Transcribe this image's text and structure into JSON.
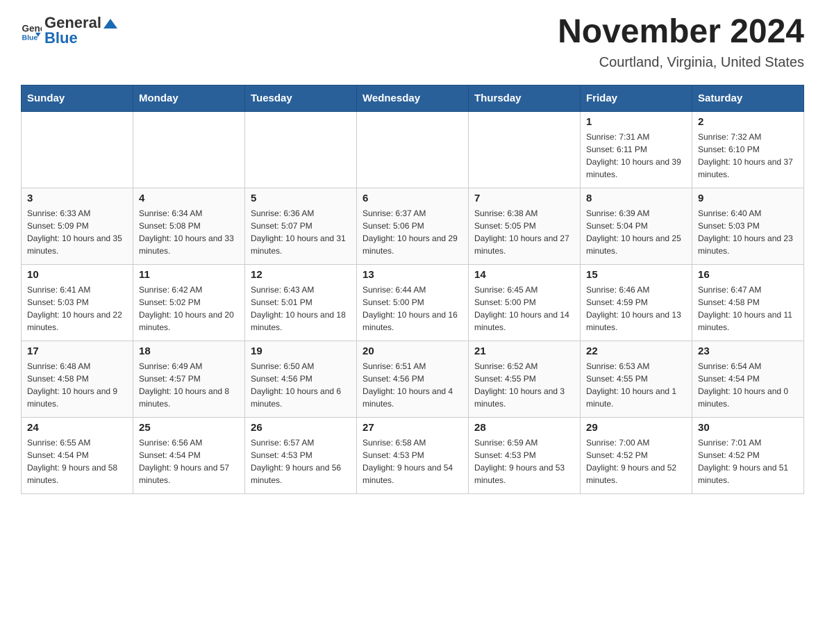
{
  "header": {
    "logo_general": "General",
    "logo_blue": "Blue",
    "month_year": "November 2024",
    "location": "Courtland, Virginia, United States"
  },
  "weekdays": [
    "Sunday",
    "Monday",
    "Tuesday",
    "Wednesday",
    "Thursday",
    "Friday",
    "Saturday"
  ],
  "weeks": [
    [
      {
        "day": "",
        "info": ""
      },
      {
        "day": "",
        "info": ""
      },
      {
        "day": "",
        "info": ""
      },
      {
        "day": "",
        "info": ""
      },
      {
        "day": "",
        "info": ""
      },
      {
        "day": "1",
        "info": "Sunrise: 7:31 AM\nSunset: 6:11 PM\nDaylight: 10 hours and 39 minutes."
      },
      {
        "day": "2",
        "info": "Sunrise: 7:32 AM\nSunset: 6:10 PM\nDaylight: 10 hours and 37 minutes."
      }
    ],
    [
      {
        "day": "3",
        "info": "Sunrise: 6:33 AM\nSunset: 5:09 PM\nDaylight: 10 hours and 35 minutes."
      },
      {
        "day": "4",
        "info": "Sunrise: 6:34 AM\nSunset: 5:08 PM\nDaylight: 10 hours and 33 minutes."
      },
      {
        "day": "5",
        "info": "Sunrise: 6:36 AM\nSunset: 5:07 PM\nDaylight: 10 hours and 31 minutes."
      },
      {
        "day": "6",
        "info": "Sunrise: 6:37 AM\nSunset: 5:06 PM\nDaylight: 10 hours and 29 minutes."
      },
      {
        "day": "7",
        "info": "Sunrise: 6:38 AM\nSunset: 5:05 PM\nDaylight: 10 hours and 27 minutes."
      },
      {
        "day": "8",
        "info": "Sunrise: 6:39 AM\nSunset: 5:04 PM\nDaylight: 10 hours and 25 minutes."
      },
      {
        "day": "9",
        "info": "Sunrise: 6:40 AM\nSunset: 5:03 PM\nDaylight: 10 hours and 23 minutes."
      }
    ],
    [
      {
        "day": "10",
        "info": "Sunrise: 6:41 AM\nSunset: 5:03 PM\nDaylight: 10 hours and 22 minutes."
      },
      {
        "day": "11",
        "info": "Sunrise: 6:42 AM\nSunset: 5:02 PM\nDaylight: 10 hours and 20 minutes."
      },
      {
        "day": "12",
        "info": "Sunrise: 6:43 AM\nSunset: 5:01 PM\nDaylight: 10 hours and 18 minutes."
      },
      {
        "day": "13",
        "info": "Sunrise: 6:44 AM\nSunset: 5:00 PM\nDaylight: 10 hours and 16 minutes."
      },
      {
        "day": "14",
        "info": "Sunrise: 6:45 AM\nSunset: 5:00 PM\nDaylight: 10 hours and 14 minutes."
      },
      {
        "day": "15",
        "info": "Sunrise: 6:46 AM\nSunset: 4:59 PM\nDaylight: 10 hours and 13 minutes."
      },
      {
        "day": "16",
        "info": "Sunrise: 6:47 AM\nSunset: 4:58 PM\nDaylight: 10 hours and 11 minutes."
      }
    ],
    [
      {
        "day": "17",
        "info": "Sunrise: 6:48 AM\nSunset: 4:58 PM\nDaylight: 10 hours and 9 minutes."
      },
      {
        "day": "18",
        "info": "Sunrise: 6:49 AM\nSunset: 4:57 PM\nDaylight: 10 hours and 8 minutes."
      },
      {
        "day": "19",
        "info": "Sunrise: 6:50 AM\nSunset: 4:56 PM\nDaylight: 10 hours and 6 minutes."
      },
      {
        "day": "20",
        "info": "Sunrise: 6:51 AM\nSunset: 4:56 PM\nDaylight: 10 hours and 4 minutes."
      },
      {
        "day": "21",
        "info": "Sunrise: 6:52 AM\nSunset: 4:55 PM\nDaylight: 10 hours and 3 minutes."
      },
      {
        "day": "22",
        "info": "Sunrise: 6:53 AM\nSunset: 4:55 PM\nDaylight: 10 hours and 1 minute."
      },
      {
        "day": "23",
        "info": "Sunrise: 6:54 AM\nSunset: 4:54 PM\nDaylight: 10 hours and 0 minutes."
      }
    ],
    [
      {
        "day": "24",
        "info": "Sunrise: 6:55 AM\nSunset: 4:54 PM\nDaylight: 9 hours and 58 minutes."
      },
      {
        "day": "25",
        "info": "Sunrise: 6:56 AM\nSunset: 4:54 PM\nDaylight: 9 hours and 57 minutes."
      },
      {
        "day": "26",
        "info": "Sunrise: 6:57 AM\nSunset: 4:53 PM\nDaylight: 9 hours and 56 minutes."
      },
      {
        "day": "27",
        "info": "Sunrise: 6:58 AM\nSunset: 4:53 PM\nDaylight: 9 hours and 54 minutes."
      },
      {
        "day": "28",
        "info": "Sunrise: 6:59 AM\nSunset: 4:53 PM\nDaylight: 9 hours and 53 minutes."
      },
      {
        "day": "29",
        "info": "Sunrise: 7:00 AM\nSunset: 4:52 PM\nDaylight: 9 hours and 52 minutes."
      },
      {
        "day": "30",
        "info": "Sunrise: 7:01 AM\nSunset: 4:52 PM\nDaylight: 9 hours and 51 minutes."
      }
    ]
  ]
}
